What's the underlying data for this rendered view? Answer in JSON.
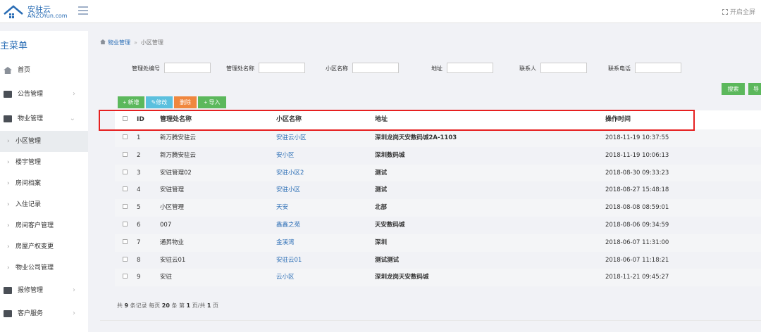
{
  "header": {
    "logo_name": "安驻云",
    "logo_url": "ANZOYun.com",
    "fullscreen_label": "开启全屏"
  },
  "sidebar": {
    "title": "主菜单",
    "items": [
      {
        "label": "首页",
        "icon": "home-icon"
      },
      {
        "label": "公告管理",
        "icon": "folder-icon"
      },
      {
        "label": "物业管理",
        "icon": "folder-icon"
      },
      {
        "label": "报修管理",
        "icon": "folder-icon"
      },
      {
        "label": "客户服务",
        "icon": "folder-icon"
      }
    ],
    "sub_items": [
      {
        "label": "小区管理"
      },
      {
        "label": "楼宇管理"
      },
      {
        "label": "房间档案"
      },
      {
        "label": "入住记录"
      },
      {
        "label": "房间客户管理"
      },
      {
        "label": "房屋产权变更"
      },
      {
        "label": "物业公司管理"
      }
    ]
  },
  "breadcrumb": {
    "parent": "物业管理",
    "current": "小区管理"
  },
  "filters": [
    {
      "label": "管理处编号",
      "value": ""
    },
    {
      "label": "管理处名称",
      "value": ""
    },
    {
      "label": "小区名称",
      "value": ""
    },
    {
      "label": "地址",
      "value": ""
    },
    {
      "label": "联系人",
      "value": ""
    },
    {
      "label": "联系电话",
      "value": ""
    }
  ],
  "buttons": {
    "search": "搜索",
    "export": "导",
    "add": "+ 新增",
    "edit": "修改",
    "delete": "删除",
    "import": "+ 导入"
  },
  "table": {
    "headers": [
      "ID",
      "管理处名称",
      "小区名称",
      "地址",
      "操作时间"
    ],
    "rows": [
      {
        "id": "1",
        "mgr": "新万腾安驻云",
        "community": "安驻云小区",
        "address": "深圳龙岗天安数码城2A-1103",
        "time": "2018-11-19 10:37:55"
      },
      {
        "id": "2",
        "mgr": "新万腾安驻云",
        "community": "安小区",
        "address": "深圳数码城",
        "time": "2018-11-19 10:06:13"
      },
      {
        "id": "3",
        "mgr": "安驻管理02",
        "community": "安驻小区2",
        "address": "测试",
        "time": "2018-08-30 09:33:23"
      },
      {
        "id": "4",
        "mgr": "安驻管理",
        "community": "安驻小区",
        "address": "测试",
        "time": "2018-08-27 15:48:18"
      },
      {
        "id": "5",
        "mgr": "小区管理",
        "community": "天安",
        "address": "北部",
        "time": "2018-08-08 08:59:01"
      },
      {
        "id": "6",
        "mgr": "007",
        "community": "鑫鑫之苑",
        "address": "天安数码城",
        "time": "2018-08-06 09:34:59"
      },
      {
        "id": "7",
        "mgr": "通昇物业",
        "community": "金溪湾",
        "address": "深圳",
        "time": "2018-06-07 11:31:00"
      },
      {
        "id": "8",
        "mgr": "安驻云01",
        "community": "安驻云01",
        "address": "测试测试",
        "time": "2018-06-07 11:18:21"
      },
      {
        "id": "9",
        "mgr": "安驻",
        "community": "云小区",
        "address": "深圳龙岗天安数码城",
        "time": "2018-11-21 09:45:27"
      }
    ]
  },
  "pager": {
    "pre_total": "共",
    "total": "9",
    "mid1": "条记录 每页",
    "per_page": "20",
    "mid2": "条 第",
    "page": "1",
    "mid3": "页/共",
    "pages": "1",
    "post": "页"
  },
  "colors": {
    "accent": "#2a6db5",
    "green": "#5cb85c",
    "blue": "#5bc0de",
    "orange": "#f0873e",
    "highlight": "#e62020"
  }
}
